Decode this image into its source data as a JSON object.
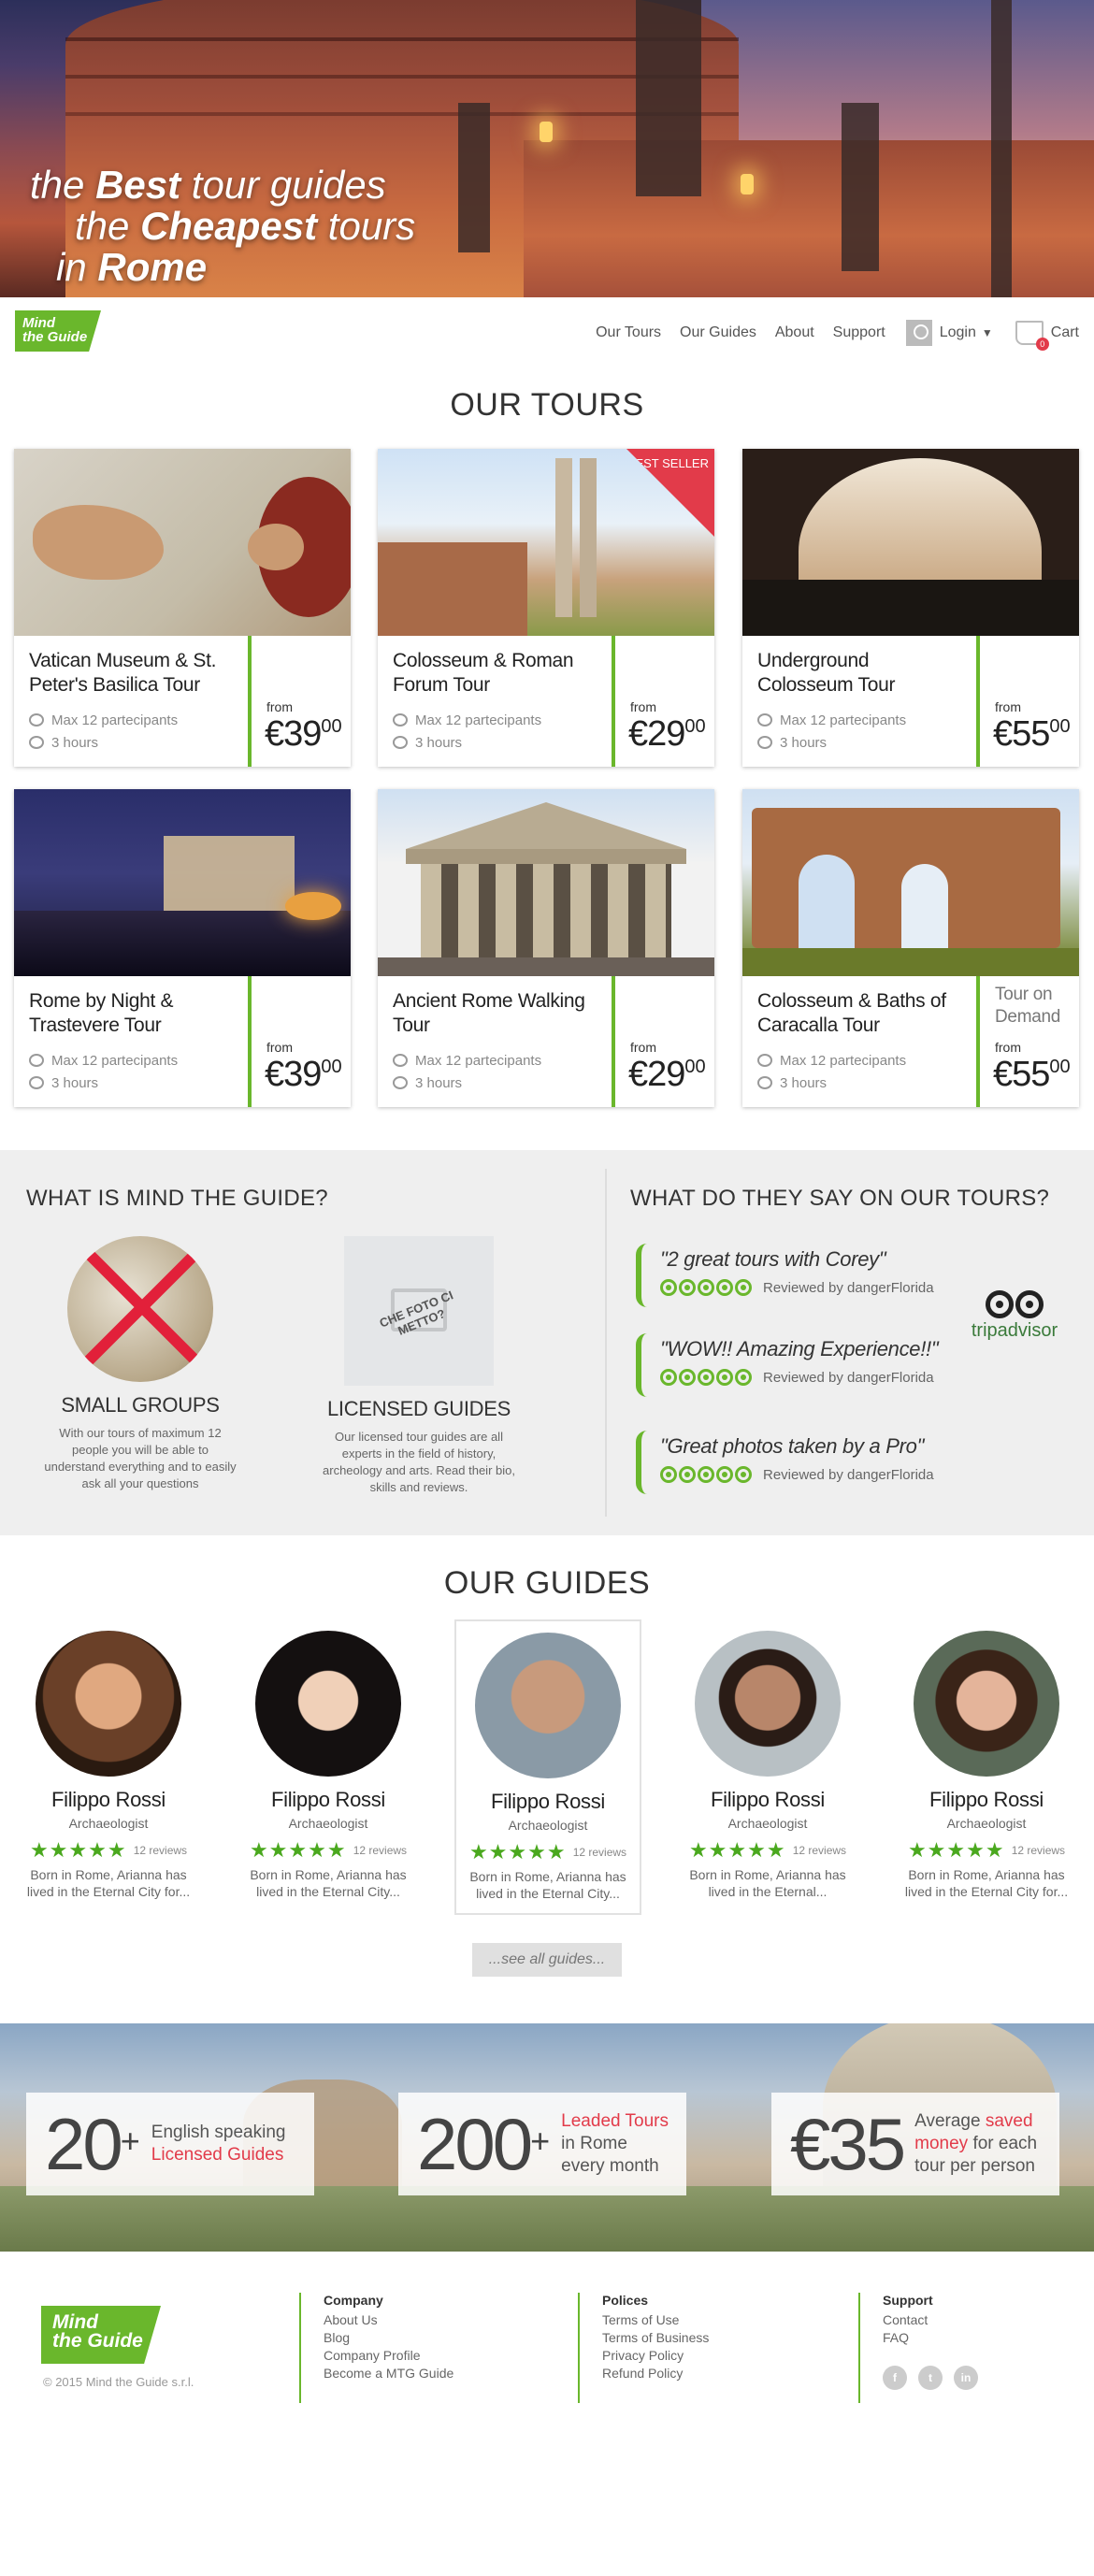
{
  "hero": {
    "line1_pre": "the ",
    "line1_bold": "Best",
    "line1_post": " tour guides",
    "line2_pre": "the ",
    "line2_bold": "Cheapest",
    "line2_post": " tours",
    "line3_pre": "in ",
    "line3_bold": "Rome"
  },
  "nav": {
    "logo_line1": "Mind",
    "logo_line2": "the Guide",
    "items": [
      "Our Tours",
      "Our Guides",
      "About",
      "Support"
    ],
    "login": "Login",
    "cart": "Cart",
    "cart_count": "0"
  },
  "tours": {
    "title": "OUR TOURS",
    "from_label": "from",
    "items": [
      {
        "name": "Vatican Museum & St. Peter's Basilica Tour",
        "participants": "Max 12 partecipants",
        "duration": "3 hours",
        "price": "€39",
        "cents": "00"
      },
      {
        "name": "Colosseum & Roman Forum Tour",
        "participants": "Max 12 partecipants",
        "duration": "3 hours",
        "price": "€29",
        "cents": "00",
        "ribbon": "BEST SELLER"
      },
      {
        "name": "Underground Colosseum Tour",
        "participants": "Max 12 partecipants",
        "duration": "3 hours",
        "price": "€55",
        "cents": "00"
      },
      {
        "name": "Rome by Night & Trastevere Tour",
        "participants": "Max 12 partecipants",
        "duration": "3 hours",
        "price": "€39",
        "cents": "00"
      },
      {
        "name": "Ancient Rome Walking Tour",
        "participants": "Max 12 partecipants",
        "duration": "3 hours",
        "price": "€29",
        "cents": "00"
      },
      {
        "name": "Colosseum & Baths of Caracalla Tour",
        "participants": "Max 12 partecipants",
        "duration": "3 hours",
        "price": "€55",
        "cents": "00",
        "on_demand": "Tour on Demand"
      }
    ]
  },
  "about": {
    "title": "WHAT IS MIND THE GUIDE?",
    "features": [
      {
        "title": "SMALL GROUPS",
        "desc": "With our tours of maximum 12 people you will be able to understand everything and to easily ask all your questions"
      },
      {
        "title": "LICENSED GUIDES",
        "desc": "Our licensed tour guides are all experts in the field of history, archeology and arts. Read their bio, skills and reviews.",
        "placeholder": "CHE FOTO CI METTO?"
      }
    ]
  },
  "reviews": {
    "title": "WHAT DO THEY SAY ON OUR TOURS?",
    "items": [
      {
        "quote": "\"2 great tours with Corey\"",
        "by": "Reviewed by dangerFlorida"
      },
      {
        "quote": "\"WOW!! Amazing Experience!!\"",
        "by": "Reviewed by dangerFlorida"
      },
      {
        "quote": "\"Great photos taken by a Pro\"",
        "by": "Reviewed by dangerFlorida"
      }
    ],
    "brand": "tripadvisor"
  },
  "guides": {
    "title": "OUR GUIDES",
    "items": [
      {
        "name": "Filippo Rossi",
        "role": "Archaeologist",
        "stars": "★★★★★",
        "reviews": "12 reviews",
        "bio": "Born in Rome, Arianna has lived in the Eternal City for..."
      },
      {
        "name": "Filippo Rossi",
        "role": "Archaeologist",
        "stars": "★★★★★",
        "reviews": "12 reviews",
        "bio": "Born in Rome, Arianna has lived in the Eternal City..."
      },
      {
        "name": "Filippo Rossi",
        "role": "Archaeologist",
        "stars": "★★★★★",
        "reviews": "12 reviews",
        "bio": "Born in Rome, Arianna has lived in the Eternal City..."
      },
      {
        "name": "Filippo Rossi",
        "role": "Archaeologist",
        "stars": "★★★★★",
        "reviews": "12 reviews",
        "bio": "Born in Rome, Arianna has lived in the Eternal..."
      },
      {
        "name": "Filippo Rossi",
        "role": "Archaeologist",
        "stars": "★★★★★",
        "reviews": "12 reviews",
        "bio": "Born in Rome, Arianna has lived in the Eternal City for..."
      }
    ],
    "see_all": "...see all guides..."
  },
  "stats": [
    {
      "big": "20",
      "plus": "+",
      "line1": "English speaking",
      "line2": "Licensed Guides"
    },
    {
      "big": "200",
      "plus": "+",
      "line1": "Leaded Tours",
      "line2": "in Rome",
      "line3": "every month"
    },
    {
      "big": "€35",
      "line1a": "Average ",
      "line1b": "saved",
      "line2a": "money",
      "line2b": " for each",
      "line3": "tour per person"
    }
  ],
  "footer": {
    "logo_line1": "Mind",
    "logo_line2": "the Guide",
    "copyright": "© 2015 Mind the Guide s.r.l.",
    "company": {
      "title": "Company",
      "links": [
        "About Us",
        "Blog",
        "Company Profile",
        "Become a MTG Guide"
      ]
    },
    "polices": {
      "title": "Polices",
      "links": [
        "Terms of Use",
        "Terms of Business",
        "Privacy Policy",
        "Refund Policy"
      ]
    },
    "support": {
      "title": "Support",
      "links": [
        "Contact",
        "FAQ"
      ]
    },
    "social": [
      "f",
      "t",
      "in"
    ]
  },
  "colors": {
    "accent": "#6ab72c",
    "highlight": "#e23b4a"
  }
}
